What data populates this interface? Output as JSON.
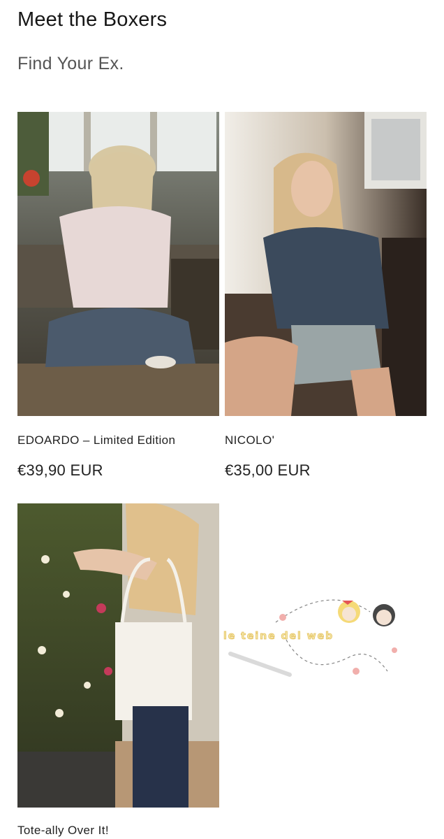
{
  "collection": {
    "title": "Meet the Boxers",
    "subtitle": "Find Your Ex."
  },
  "products": [
    {
      "name": "EDOARDO – Limited Edition",
      "price": "€39,90 EUR"
    },
    {
      "name": "NICOLO'",
      "price": "€35,00 EUR"
    },
    {
      "name": "Tote-ally Over It!"
    }
  ],
  "watermark": {
    "logo_text": "le teine del web"
  }
}
